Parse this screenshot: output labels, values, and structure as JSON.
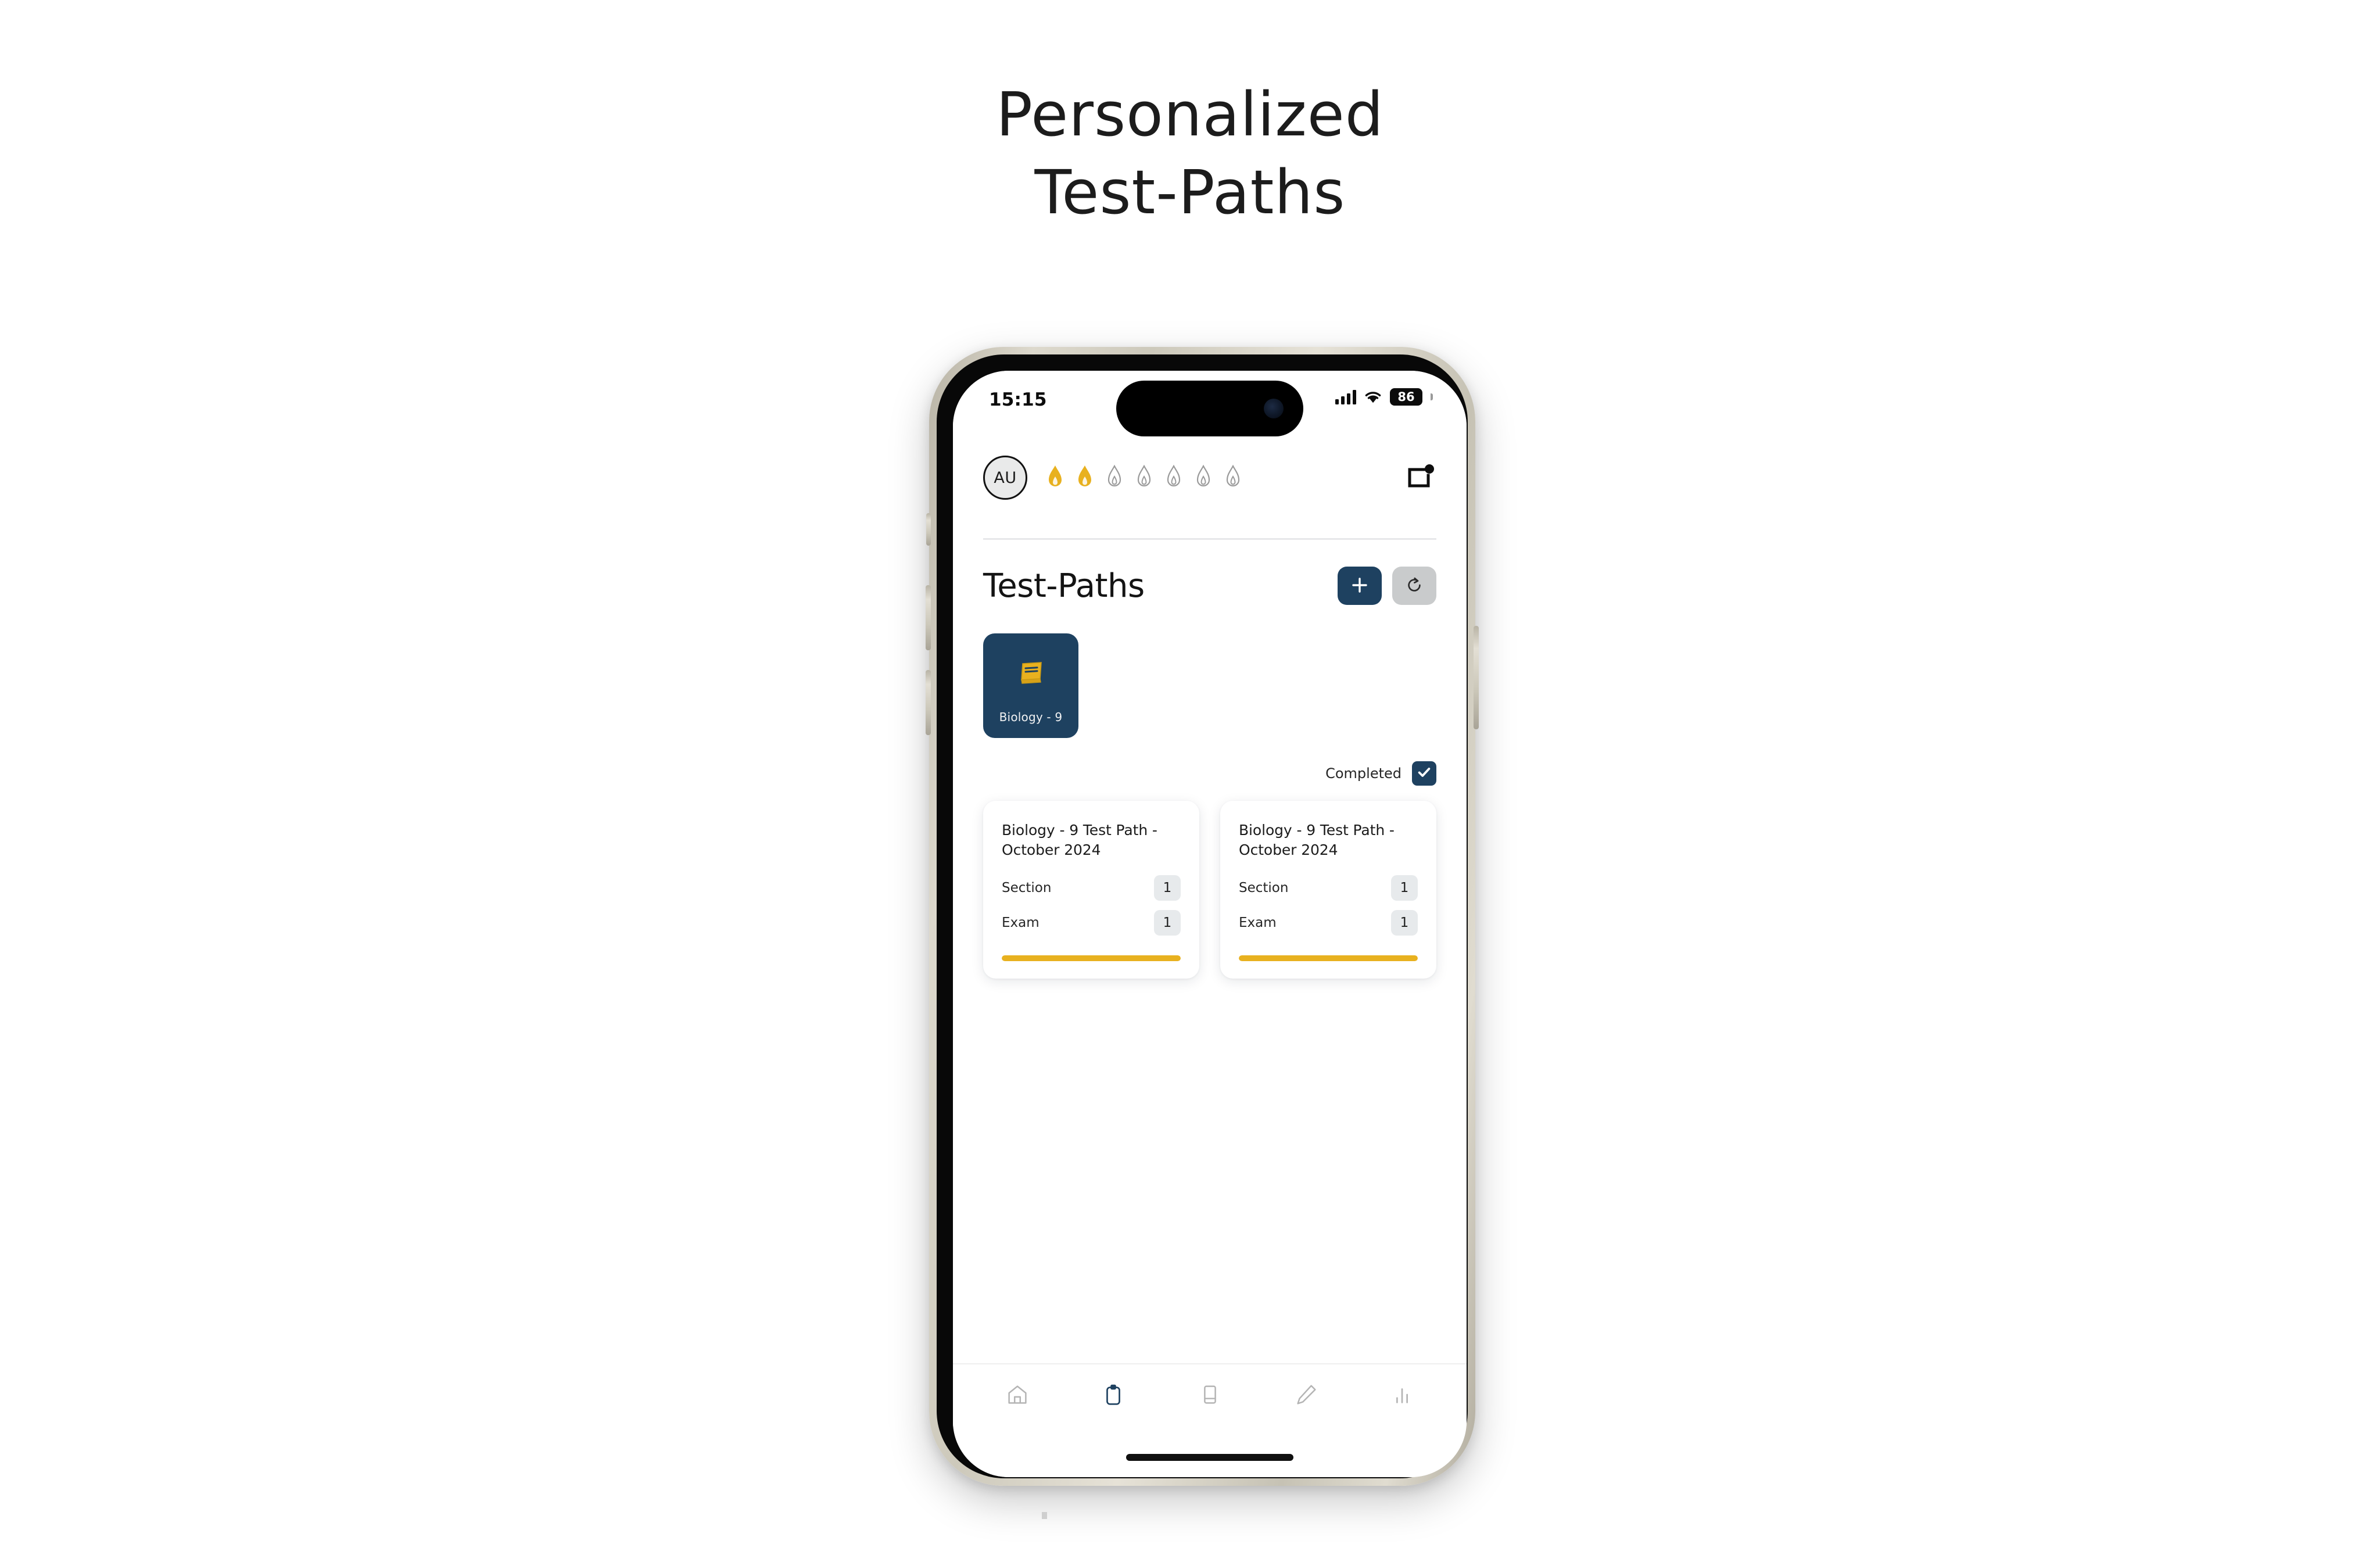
{
  "poster": {
    "headline_line1": "Personalized",
    "headline_line2": "Test-Paths"
  },
  "colors": {
    "navy": "#1e4160",
    "gold": "#e8b11f",
    "badge_gray": "#e7eaec",
    "refresh_gray": "#c9cbcc",
    "frame_titanium": "#cdc9bb"
  },
  "status_bar": {
    "time": "15:15",
    "signal_icon": "cellular-signal-icon",
    "wifi_icon": "wifi-icon",
    "battery_level": "86"
  },
  "top_bar": {
    "avatar_initials": "AU",
    "notification_icon": "notification-badge-icon",
    "streak": {
      "total": 7,
      "active": 2,
      "flames": [
        {
          "state": "active"
        },
        {
          "state": "active"
        },
        {
          "state": "inactive"
        },
        {
          "state": "inactive"
        },
        {
          "state": "inactive"
        },
        {
          "state": "inactive"
        },
        {
          "state": "inactive"
        }
      ]
    }
  },
  "header": {
    "title": "Test-Paths",
    "add_button_icon": "plus-icon",
    "refresh_button_icon": "refresh-icon"
  },
  "subjects": [
    {
      "label": "Biology - 9",
      "icon": "book-icon"
    }
  ],
  "filter": {
    "completed_label": "Completed",
    "completed_checked": true,
    "check_icon": "check-icon"
  },
  "test_paths": [
    {
      "title": "Biology - 9 Test Path - October 2024",
      "stats": [
        {
          "label": "Section",
          "value": "1"
        },
        {
          "label": "Exam",
          "value": "1"
        }
      ],
      "progress_percent": 100
    },
    {
      "title": "Biology - 9 Test Path - October 2024",
      "stats": [
        {
          "label": "Section",
          "value": "1"
        },
        {
          "label": "Exam",
          "value": "1"
        }
      ],
      "progress_percent": 100
    }
  ],
  "bottom_nav": [
    {
      "icon": "home-icon",
      "active": false
    },
    {
      "icon": "clipboard-icon",
      "active": true
    },
    {
      "icon": "book-icon",
      "active": false
    },
    {
      "icon": "pencil-icon",
      "active": false
    },
    {
      "icon": "bar-chart-icon",
      "active": false
    }
  ]
}
